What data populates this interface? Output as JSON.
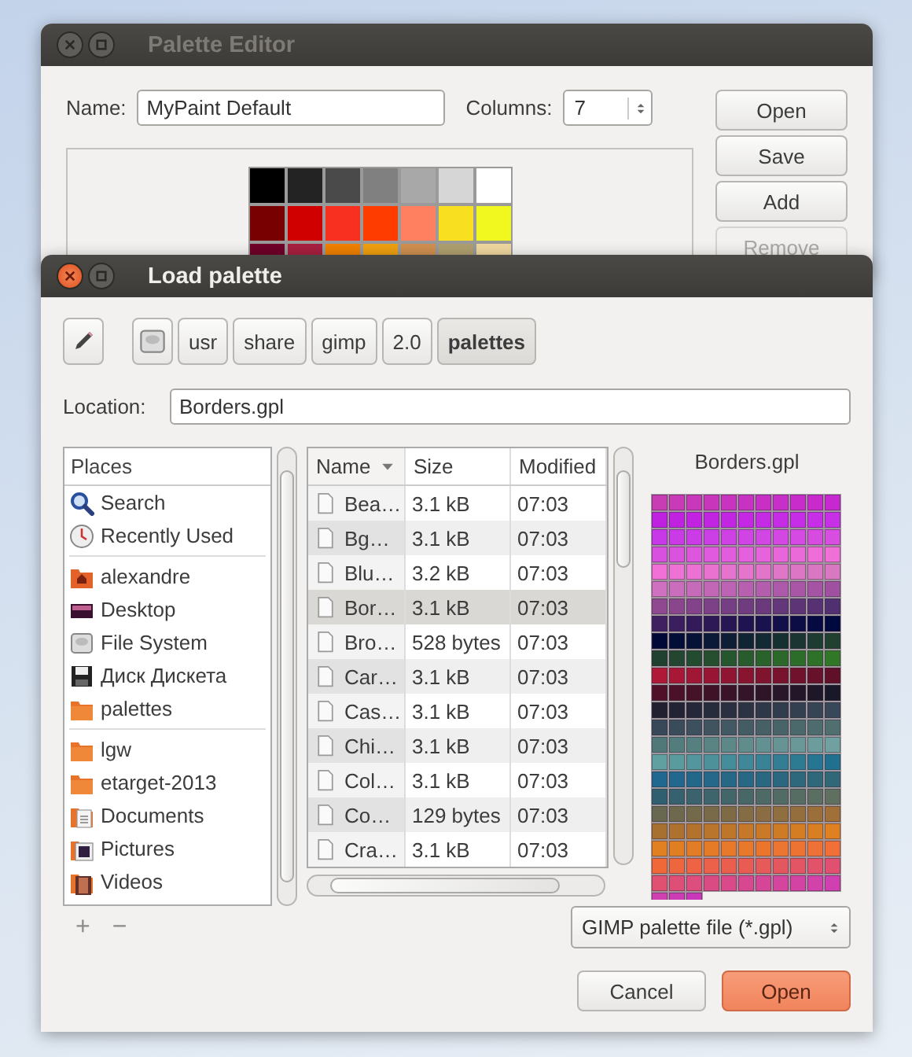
{
  "editor_window": {
    "title": "Palette Editor",
    "active": false,
    "name_label": "Name:",
    "name_value": "MyPaint Default",
    "columns_label": "Columns:",
    "columns_value": "7",
    "buttons": [
      {
        "label": "Open",
        "disabled": false
      },
      {
        "label": "Save",
        "disabled": false
      },
      {
        "label": "Add",
        "disabled": false
      },
      {
        "label": "Remove",
        "disabled": true
      }
    ],
    "swatch_rows": [
      {
        "cells": [
          {
            "color": "#000000"
          },
          {
            "color": "#232323"
          },
          {
            "color": "#4a4a4a"
          },
          {
            "color": "#808080"
          },
          {
            "color": "#a8a8a8"
          },
          {
            "color": "#d6d6d6"
          },
          {
            "color": "#ffffff"
          }
        ]
      },
      {
        "cells": [
          {
            "color": "#780000"
          },
          {
            "color": "#d00000"
          },
          {
            "color": "#f83020"
          },
          {
            "color": "#ff3c00"
          },
          {
            "color": "#ff8060"
          },
          {
            "color": "#f8e020"
          },
          {
            "color": "#f0f820"
          }
        ]
      },
      {
        "cells": [
          {
            "color": "#700028"
          },
          {
            "color": "#a82040"
          },
          {
            "color": "#f08000"
          },
          {
            "color": "#f0a010"
          },
          {
            "color": "#d09050"
          },
          {
            "color": "#b0a070"
          },
          {
            "color": "#f0d8a0"
          }
        ]
      }
    ]
  },
  "load_dialog": {
    "title": "Load palette",
    "active": true,
    "path": [
      {
        "kind": "drive",
        "selected": false
      },
      {
        "kind": "folder",
        "label": "usr",
        "selected": false
      },
      {
        "kind": "folder",
        "label": "share",
        "selected": false
      },
      {
        "kind": "folder",
        "label": "gimp",
        "selected": false
      },
      {
        "kind": "folder",
        "label": "2.0",
        "selected": false
      },
      {
        "kind": "folder",
        "label": "palettes",
        "selected": true
      }
    ],
    "location_label": "Location:",
    "location_value": "Borders.gpl",
    "places_header": "Places",
    "places_groups": [
      [
        {
          "label": "Search",
          "kind": "search"
        },
        {
          "label": "Recently Used",
          "kind": "recent"
        }
      ],
      [
        {
          "label": "alexandre",
          "kind": "home"
        },
        {
          "label": "Desktop",
          "kind": "desktop"
        },
        {
          "label": "File System",
          "kind": "drive"
        },
        {
          "label": "Диск Дискета",
          "kind": "floppy"
        },
        {
          "label": "palettes",
          "kind": "folder"
        }
      ],
      [
        {
          "label": "lgw",
          "kind": "folder"
        },
        {
          "label": "etarget-2013",
          "kind": "folder"
        },
        {
          "label": "Documents",
          "kind": "documents"
        },
        {
          "label": "Pictures",
          "kind": "pictures"
        },
        {
          "label": "Videos",
          "kind": "videos"
        }
      ]
    ],
    "places_buttons": [
      {
        "label": "+",
        "disabled": true
      },
      {
        "label": "−",
        "disabled": true
      }
    ],
    "columns": [
      {
        "label": "Name",
        "sorted": true
      },
      {
        "label": "Size",
        "sorted": false
      },
      {
        "label": "Modified",
        "sorted": false
      }
    ],
    "files": [
      {
        "name": "Bea…",
        "size": "3.1 kB",
        "modified": "07:03",
        "selected": false
      },
      {
        "name": "Bg…",
        "size": "3.1 kB",
        "modified": "07:03",
        "selected": false
      },
      {
        "name": "Blu…",
        "size": "3.2 kB",
        "modified": "07:03",
        "selected": false
      },
      {
        "name": "Bor…",
        "size": "3.1 kB",
        "modified": "07:03",
        "selected": true
      },
      {
        "name": "Bro…",
        "size": "528 bytes",
        "modified": "07:03",
        "selected": false
      },
      {
        "name": "Car…",
        "size": "3.1 kB",
        "modified": "07:03",
        "selected": false
      },
      {
        "name": "Cas…",
        "size": "3.1 kB",
        "modified": "07:03",
        "selected": false
      },
      {
        "name": "Chi…",
        "size": "3.1 kB",
        "modified": "07:03",
        "selected": false
      },
      {
        "name": "Col…",
        "size": "3.1 kB",
        "modified": "07:03",
        "selected": false
      },
      {
        "name": "Co…",
        "size": "129 bytes",
        "modified": "07:03",
        "selected": false
      },
      {
        "name": "Cra…",
        "size": "3.1 kB",
        "modified": "07:03",
        "selected": false
      }
    ],
    "preview": {
      "title": "Borders.gpl",
      "rows": [
        {
          "cells": [
            {
              "color": "#c83cb4"
            },
            {
              "color": "#c83ab7"
            },
            {
              "color": "#c838ba"
            },
            {
              "color": "#c836bc"
            },
            {
              "color": "#c834bf"
            },
            {
              "color": "#c832c2"
            },
            {
              "color": "#c830c5"
            },
            {
              "color": "#c82ec8"
            },
            {
              "color": "#c82cca"
            },
            {
              "color": "#c82acd"
            },
            {
              "color": "#c828d0"
            }
          ]
        },
        {
          "cells": [
            {
              "color": "#c020e0"
            },
            {
              "color": "#c122e1"
            },
            {
              "color": "#c223e2"
            },
            {
              "color": "#c225e2"
            },
            {
              "color": "#c326e3"
            },
            {
              "color": "#c428e4"
            },
            {
              "color": "#c52ae5"
            },
            {
              "color": "#c62be6"
            },
            {
              "color": "#c62de6"
            },
            {
              "color": "#c72ee7"
            },
            {
              "color": "#c830e8"
            }
          ]
        },
        {
          "cells": [
            {
              "color": "#c838e8"
            },
            {
              "color": "#ca3ae7"
            },
            {
              "color": "#cb3ce6"
            },
            {
              "color": "#cd3fe6"
            },
            {
              "color": "#ce41e5"
            },
            {
              "color": "#d043e4"
            },
            {
              "color": "#d246e3"
            },
            {
              "color": "#d348e2"
            },
            {
              "color": "#d54ae2"
            },
            {
              "color": "#d64ce1"
            },
            {
              "color": "#d84ee0"
            }
          ]
        },
        {
          "cells": [
            {
              "color": "#d850e0"
            },
            {
              "color": "#da53df"
            },
            {
              "color": "#dd56de"
            },
            {
              "color": "#df5ade"
            },
            {
              "color": "#e25ddd"
            },
            {
              "color": "#e460dc"
            },
            {
              "color": "#e663db"
            },
            {
              "color": "#e966da"
            },
            {
              "color": "#eb6ada"
            },
            {
              "color": "#ee6dd9"
            },
            {
              "color": "#f070d8"
            }
          ]
        },
        {
          "cells": [
            {
              "color": "#f070d8"
            },
            {
              "color": "#ee71d6"
            },
            {
              "color": "#eb72d3"
            },
            {
              "color": "#e972d1"
            },
            {
              "color": "#e673ce"
            },
            {
              "color": "#e474cc"
            },
            {
              "color": "#e275ca"
            },
            {
              "color": "#df76c7"
            },
            {
              "color": "#dd76c5"
            },
            {
              "color": "#da77c2"
            },
            {
              "color": "#d878c0"
            }
          ]
        },
        {
          "cells": [
            {
              "color": "#d070c0"
            },
            {
              "color": "#cb6dbd"
            },
            {
              "color": "#c66aba"
            },
            {
              "color": "#c266b6"
            },
            {
              "color": "#bd63b3"
            },
            {
              "color": "#b860b0"
            },
            {
              "color": "#b35dad"
            },
            {
              "color": "#ae5aaa"
            },
            {
              "color": "#aa56a6"
            },
            {
              "color": "#a553a3"
            },
            {
              "color": "#a050a0"
            }
          ]
        },
        {
          "cells": [
            {
              "color": "#904890"
            },
            {
              "color": "#8a468d"
            },
            {
              "color": "#83438a"
            },
            {
              "color": "#7d4187"
            },
            {
              "color": "#763e83"
            },
            {
              "color": "#703c80"
            },
            {
              "color": "#6a3a7d"
            },
            {
              "color": "#633779"
            },
            {
              "color": "#5d3576"
            },
            {
              "color": "#563273"
            },
            {
              "color": "#503070"
            }
          ]
        },
        {
          "cells": [
            {
              "color": "#402060"
            },
            {
              "color": "#3a1e5d"
            },
            {
              "color": "#331b5a"
            },
            {
              "color": "#2d1956"
            },
            {
              "color": "#261653"
            },
            {
              "color": "#201450"
            },
            {
              "color": "#1a124d"
            },
            {
              "color": "#130f49"
            },
            {
              "color": "#0d0d46"
            },
            {
              "color": "#060a43"
            },
            {
              "color": "#000840"
            }
          ]
        },
        {
          "cells": [
            {
              "color": "#000838"
            },
            {
              "color": "#030e37"
            },
            {
              "color": "#061336"
            },
            {
              "color": "#0a1937"
            },
            {
              "color": "#0d1e35"
            },
            {
              "color": "#102434"
            },
            {
              "color": "#132a33"
            },
            {
              "color": "#163032"
            },
            {
              "color": "#1a3532"
            },
            {
              "color": "#1d3b31"
            },
            {
              "color": "#204030"
            }
          ]
        },
        {
          "cells": [
            {
              "color": "#204030"
            },
            {
              "color": "#224630"
            },
            {
              "color": "#234b2f"
            },
            {
              "color": "#254f2e"
            },
            {
              "color": "#26562e"
            },
            {
              "color": "#285c2c"
            },
            {
              "color": "#2a622b"
            },
            {
              "color": "#2b682a"
            },
            {
              "color": "#2d6d2a"
            },
            {
              "color": "#2e7229"
            },
            {
              "color": "#307828"
            }
          ]
        },
        {
          "cells": [
            {
              "color": "#b01838"
            },
            {
              "color": "#a81736"
            },
            {
              "color": "#a01635"
            },
            {
              "color": "#981634"
            },
            {
              "color": "#901532"
            },
            {
              "color": "#881430"
            },
            {
              "color": "#80132e"
            },
            {
              "color": "#78122d"
            },
            {
              "color": "#70122c"
            },
            {
              "color": "#68112a"
            },
            {
              "color": "#601028"
            }
          ]
        },
        {
          "cells": [
            {
              "color": "#501028"
            },
            {
              "color": "#4a1128"
            },
            {
              "color": "#451227"
            },
            {
              "color": "#3f1228"
            },
            {
              "color": "#3a1328"
            },
            {
              "color": "#341428"
            },
            {
              "color": "#2e1528"
            },
            {
              "color": "#291629"
            },
            {
              "color": "#231628"
            },
            {
              "color": "#1e1728"
            },
            {
              "color": "#181828"
            }
          ]
        },
        {
          "cells": [
            {
              "color": "#202030"
            },
            {
              "color": "#222434"
            },
            {
              "color": "#252838"
            },
            {
              "color": "#272c3c"
            },
            {
              "color": "#2a3040"
            },
            {
              "color": "#2c3444"
            },
            {
              "color": "#2e3848"
            },
            {
              "color": "#313c4c"
            },
            {
              "color": "#334050"
            },
            {
              "color": "#364454"
            },
            {
              "color": "#384858"
            }
          ]
        },
        {
          "cells": [
            {
              "color": "#384859"
            },
            {
              "color": "#3a4c5a"
            },
            {
              "color": "#3d505d"
            },
            {
              "color": "#3f545f"
            },
            {
              "color": "#425862"
            },
            {
              "color": "#445c64"
            },
            {
              "color": "#466066"
            },
            {
              "color": "#496469"
            },
            {
              "color": "#4b686b"
            },
            {
              "color": "#4e6c6e"
            },
            {
              "color": "#507070"
            }
          ]
        },
        {
          "cells": [
            {
              "color": "#507878"
            },
            {
              "color": "#537c7c"
            },
            {
              "color": "#568080"
            },
            {
              "color": "#5a8484"
            },
            {
              "color": "#5d8888"
            },
            {
              "color": "#608c8c"
            },
            {
              "color": "#639090"
            },
            {
              "color": "#669494"
            },
            {
              "color": "#6a9898"
            },
            {
              "color": "#6d9c9c"
            },
            {
              "color": "#70a0a0"
            }
          ]
        },
        {
          "cells": [
            {
              "color": "#60a0a0"
            },
            {
              "color": "#5a9b9e"
            },
            {
              "color": "#53969d"
            },
            {
              "color": "#4d929b"
            },
            {
              "color": "#468d9a"
            },
            {
              "color": "#408898"
            },
            {
              "color": "#3a8396"
            },
            {
              "color": "#337e95"
            },
            {
              "color": "#2d7a93"
            },
            {
              "color": "#267592"
            },
            {
              "color": "#207090"
            }
          ]
        },
        {
          "cells": [
            {
              "color": "#206890"
            },
            {
              "color": "#22688e"
            },
            {
              "color": "#23688b"
            },
            {
              "color": "#256889"
            },
            {
              "color": "#266886"
            },
            {
              "color": "#286884"
            },
            {
              "color": "#2a6882"
            },
            {
              "color": "#2b687f"
            },
            {
              "color": "#2d687d"
            },
            {
              "color": "#2e687a"
            },
            {
              "color": "#306878"
            }
          ]
        },
        {
          "cells": [
            {
              "color": "#306070"
            },
            {
              "color": "#35626e"
            },
            {
              "color": "#3a636d"
            },
            {
              "color": "#3e656b"
            },
            {
              "color": "#43666a"
            },
            {
              "color": "#486868"
            },
            {
              "color": "#4d6a66"
            },
            {
              "color": "#526b65"
            },
            {
              "color": "#566d63"
            },
            {
              "color": "#5b6e62"
            },
            {
              "color": "#607060"
            }
          ]
        },
        {
          "cells": [
            {
              "color": "#686850"
            },
            {
              "color": "#6e694e"
            },
            {
              "color": "#736a4b"
            },
            {
              "color": "#796a49"
            },
            {
              "color": "#7e6b46"
            },
            {
              "color": "#846c44"
            },
            {
              "color": "#8a6d42"
            },
            {
              "color": "#8f6e3f"
            },
            {
              "color": "#956e3d"
            },
            {
              "color": "#9a6f3a"
            },
            {
              "color": "#a07038"
            }
          ]
        },
        {
          "cells": [
            {
              "color": "#a87030"
            },
            {
              "color": "#ae722e"
            },
            {
              "color": "#b3732d"
            },
            {
              "color": "#b9752b"
            },
            {
              "color": "#be762a"
            },
            {
              "color": "#c47828"
            },
            {
              "color": "#ca7a26"
            },
            {
              "color": "#cf7b25"
            },
            {
              "color": "#d57d23"
            },
            {
              "color": "#da7e22"
            },
            {
              "color": "#e08020"
            }
          ]
        },
        {
          "cells": [
            {
              "color": "#e08021"
            },
            {
              "color": "#e27e22"
            },
            {
              "color": "#e37d25"
            },
            {
              "color": "#e57b27"
            },
            {
              "color": "#e6792a"
            },
            {
              "color": "#e8782c"
            },
            {
              "color": "#ea762e"
            },
            {
              "color": "#eb7531"
            },
            {
              "color": "#ed7333"
            },
            {
              "color": "#ee7236"
            },
            {
              "color": "#f07038"
            }
          ]
        },
        {
          "cells": [
            {
              "color": "#f06838"
            },
            {
              "color": "#ee663e"
            },
            {
              "color": "#ed6343"
            },
            {
              "color": "#eb6149"
            },
            {
              "color": "#ea5e4e"
            },
            {
              "color": "#e85c54"
            },
            {
              "color": "#e65a5a"
            },
            {
              "color": "#e5575f"
            },
            {
              "color": "#e35565"
            },
            {
              "color": "#e2526a"
            },
            {
              "color": "#e05070"
            }
          ]
        },
        {
          "cells": [
            {
              "color": "#e05071"
            },
            {
              "color": "#de4e76"
            },
            {
              "color": "#dd4d7d"
            },
            {
              "color": "#db4b83"
            },
            {
              "color": "#da4a8a"
            },
            {
              "color": "#d84890"
            },
            {
              "color": "#d64696"
            },
            {
              "color": "#d5459d"
            },
            {
              "color": "#d343a3"
            },
            {
              "color": "#d242aa"
            },
            {
              "color": "#d040b0"
            }
          ]
        },
        {
          "cells": [
            {
              "color": "#d040b1"
            },
            {
              "color": "#cc3cb4"
            },
            {
              "color": "#c838b8"
            }
          ]
        }
      ]
    },
    "filter": "GIMP palette file (*.gpl)",
    "buttons": [
      {
        "label": "Cancel",
        "kind": "normal"
      },
      {
        "label": "Open",
        "kind": "default"
      }
    ]
  }
}
